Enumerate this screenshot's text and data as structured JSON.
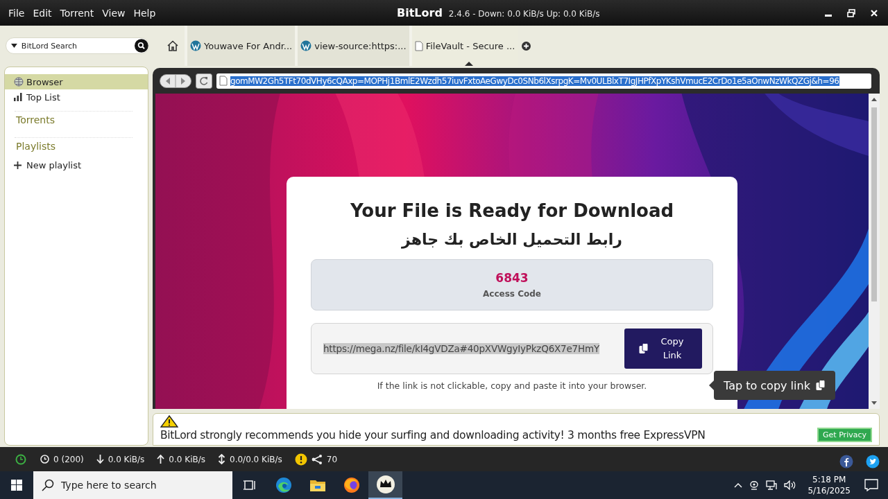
{
  "menu": [
    "File",
    "Edit",
    "Torrent",
    "View",
    "Help"
  ],
  "window": {
    "title": "BitLord",
    "subtitle": "2.4.6 - Down: 0.0 KiB/s Up: 0.0 KiB/s"
  },
  "search": {
    "placeholder": "BitLord Search"
  },
  "tabs": [
    {
      "label": "Youwave For Andr...",
      "kind": "wordpress",
      "selected": false
    },
    {
      "label": "view-source:https:...",
      "kind": "wordpress",
      "selected": false
    },
    {
      "label": "FileVault - Secure ...",
      "kind": "page",
      "selected": true
    }
  ],
  "sidebar": {
    "items": [
      {
        "kind": "item",
        "label": "Browser",
        "selected": true
      },
      {
        "kind": "item",
        "label": "Top List",
        "selected": false
      },
      {
        "kind": "heading",
        "label": "Torrents"
      },
      {
        "kind": "heading",
        "label": "Playlists"
      },
      {
        "kind": "action",
        "label": "New playlist"
      }
    ]
  },
  "address_bar": {
    "value": "gomMW2Gh5TFt70dVHy6cQAxp=MOPHj1BmlE2Wzdh57iuvFxtoAeGwyDc0SNb6lXsrpgK=Mv0ULBlxT7IgJHPfXpYKshVmucE2CrDo1e5aOnwNzWkQZGj&h=96"
  },
  "page": {
    "heading": "Your File is Ready for Download",
    "subheading": "رابط التحميل الخاص بك جاهز",
    "access_code": "6843",
    "access_label": "Access Code",
    "link": "https://mega.nz/file/kI4gVDZa#40pXVWgyIyPkzQ6X7e7HmY",
    "copy_button": "Copy Link",
    "tooltip": "Tap to copy link",
    "note": "If the link is not clickable, copy and paste it into your browser."
  },
  "ad": {
    "text": "BitLord strongly recommends you hide your surfing and downloading activity! 3 months free ExpressVPN",
    "button": "Get Privacy"
  },
  "status_bar": [
    {
      "text": "0 (200)"
    },
    {
      "text": "0.0 KiB/s"
    },
    {
      "text": "0.0 KiB/s"
    },
    {
      "text": "0.0/0.0 KiB/s"
    },
    {
      "text": "70"
    }
  ],
  "taskbar": {
    "search_placeholder": "Type here to search",
    "apps": [
      {
        "selected": false
      },
      {
        "selected": false
      },
      {
        "selected": false
      },
      {
        "selected": false
      },
      {
        "selected": true
      }
    ],
    "time": "5:18 PM",
    "date": "5/16/2025"
  }
}
